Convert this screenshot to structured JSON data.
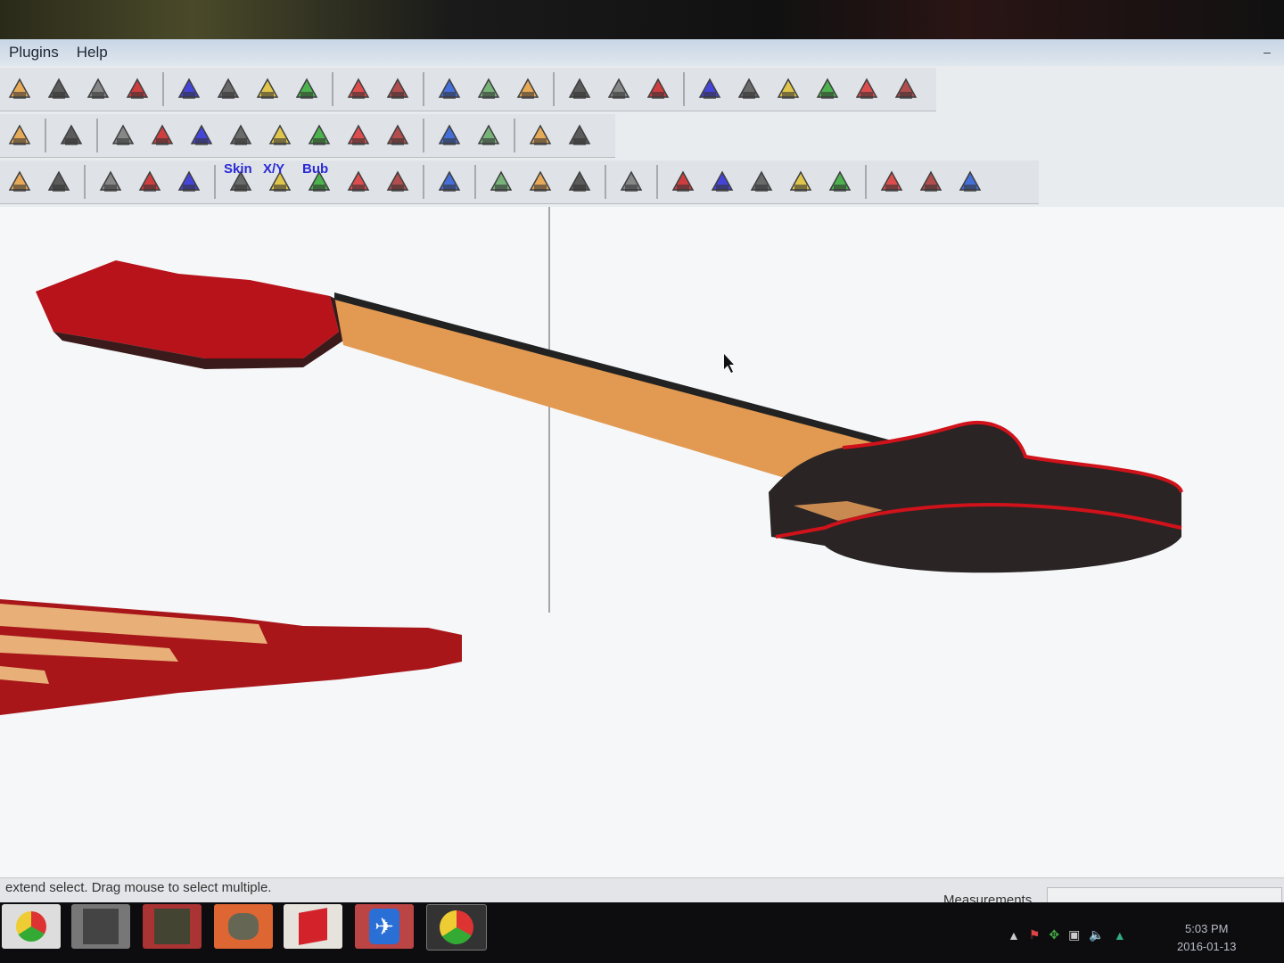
{
  "menu": {
    "items": [
      "Plugins",
      "Help"
    ],
    "minimize": "–"
  },
  "toolbars": {
    "row1": [
      "move",
      "rotate",
      "follow-me",
      "offset",
      "orbit",
      "pan",
      "zoom",
      "zoom-extents",
      "import",
      "sandbox",
      "photo-textures",
      "location",
      "geo-globe",
      "get-models",
      "share-model",
      "share-component",
      "iso-view",
      "front-view",
      "top-view",
      "right-view",
      "back-view",
      "left-view"
    ],
    "row2": [
      "sandbox-surface",
      "smoove",
      "draw-rect",
      "draw-circle",
      "draw-hexagon",
      "draw-octagon",
      "draw-parallelogram",
      "draw-arc",
      "draw-ellipse",
      "fillet",
      "polyline",
      "curve-edit",
      "scale-line",
      "colorize"
    ],
    "row3": [
      "solid-cube",
      "shaded-cube",
      "shell",
      "weld",
      "soften",
      "skin",
      "xy",
      "bub",
      "play",
      "stop",
      "hook",
      "solid-union",
      "solid-intersect",
      "solid-subtract",
      "flip-normals",
      "extrude",
      "push-up",
      "push-down",
      "stretch",
      "bend",
      "undo",
      "redo",
      "rotate-clone"
    ],
    "row3_labels": {
      "skin": "Skin",
      "xy": "X/Y",
      "bub": "Bub"
    }
  },
  "status": {
    "hint": "extend select. Drag mouse to select multiple.",
    "measurements_label": "Measurements",
    "measurements_value": ""
  },
  "taskbar": {
    "apps": [
      "chrome",
      "game-1",
      "game-2",
      "gimp",
      "sketchup",
      "airplane-app",
      "chrome-active"
    ],
    "time": "5:03 PM",
    "date": "2016-01-13"
  },
  "colors": {
    "body_red": "#c0121a",
    "body_dark": "#2a2424",
    "neck_wood": "#e29a52",
    "accent_blue": "#2a2ad6"
  }
}
